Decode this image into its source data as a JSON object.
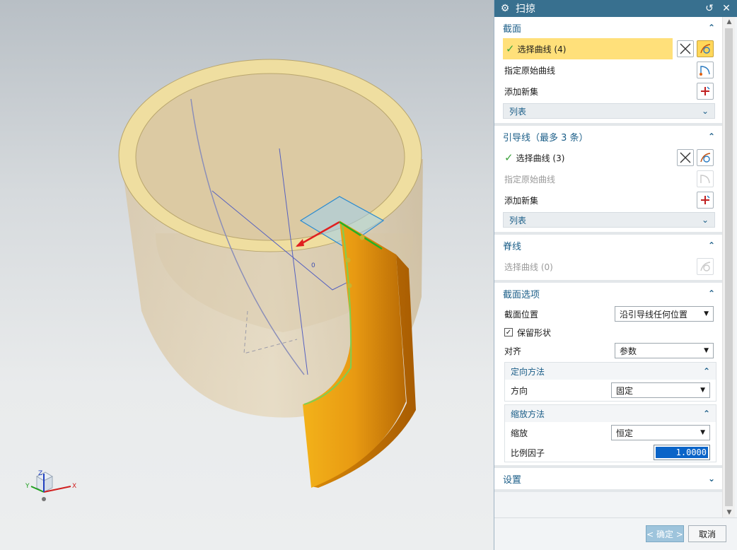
{
  "viewport": {
    "triad": {
      "x_label": "X",
      "y_label": "Y",
      "z_label": "Z"
    },
    "annotation": "0"
  },
  "dialog": {
    "title": "扫掠",
    "colors": {
      "titlebar": "#38708f",
      "highlight": "#ffe07a",
      "accent": "#1b5e88",
      "check": "#3aa23a"
    },
    "section": {
      "header": "截面",
      "select_curve": "选择曲线 (4)",
      "specify_origin": "指定原始曲线",
      "add_new_set": "添加新集",
      "list": "列表"
    },
    "guide": {
      "header": "引导线（最多 3 条）",
      "select_curve": "选择曲线 (3)",
      "specify_origin": "指定原始曲线",
      "add_new_set": "添加新集",
      "list": "列表"
    },
    "spine": {
      "header": "脊线",
      "select_curve": "选择曲线 (0)"
    },
    "section_options": {
      "header": "截面选项",
      "position_label": "截面位置",
      "position_value": "沿引导线任何位置",
      "preserve_shape": "保留形状",
      "preserve_checked": true,
      "align_label": "对齐",
      "align_value": "参数",
      "orientation": {
        "header": "定向方法",
        "direction_label": "方向",
        "direction_value": "固定"
      },
      "scaling": {
        "header": "缩放方法",
        "scale_label": "缩放",
        "scale_value": "恒定",
        "factor_label": "比例因子",
        "factor_value": "1.0000"
      }
    },
    "settings": {
      "header": "设置"
    },
    "footer": {
      "ok": "< 确定 >",
      "cancel": "取消"
    }
  }
}
